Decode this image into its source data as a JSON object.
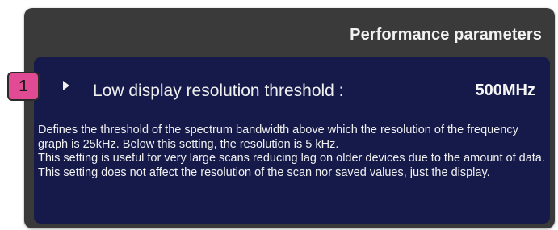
{
  "panel": {
    "title": "Performance parameters"
  },
  "setting": {
    "label": "Low display resolution threshold :",
    "value": "500MHz",
    "expander_icon": "caret-right-icon",
    "description": [
      "Defines the threshold of the spectrum bandwidth above which the resolution of the frequency graph is 25kHz. Below this setting, the resolution is 5 kHz.",
      "This setting is useful for very large scans reducing lag on older devices due to the amount of data.",
      "This setting does not affect the resolution of the scan nor saved values, just the display."
    ]
  },
  "annotation": {
    "badge_number": "1",
    "badge_color": "#e04b93"
  },
  "colors": {
    "panel_background": "#3a3a3a",
    "setting_background": "#161a4a",
    "text": "#f0f0f0"
  }
}
